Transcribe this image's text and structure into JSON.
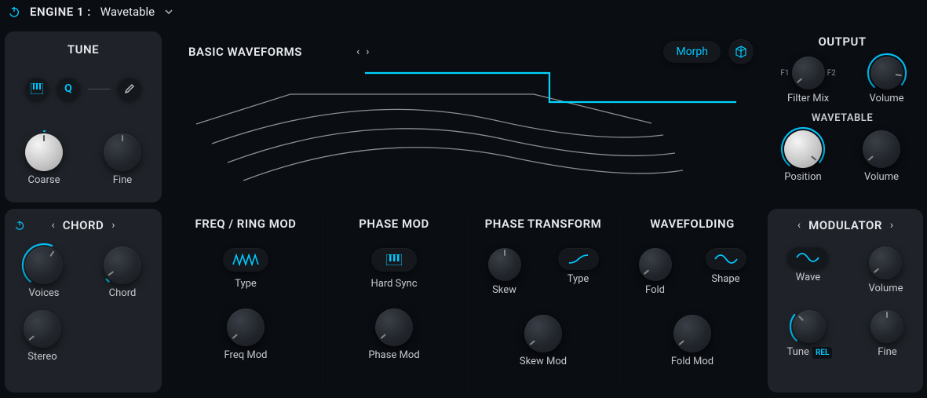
{
  "header": {
    "engine_label": "ENGINE 1 :",
    "engine_type": "Wavetable"
  },
  "tune": {
    "title": "TUNE",
    "coarse": "Coarse",
    "fine": "Fine"
  },
  "waveforms": {
    "title": "BASIC WAVEFORMS",
    "morph": "Morph"
  },
  "output": {
    "title": "OUTPUT",
    "f1": "F1",
    "f2": "F2",
    "filter_mix": "Filter Mix",
    "volume": "Volume",
    "wavetable_title": "WAVETABLE",
    "position": "Position",
    "wt_volume": "Volume"
  },
  "chord": {
    "title": "CHORD",
    "voices": "Voices",
    "chord": "Chord",
    "stereo": "Stereo"
  },
  "freqring": {
    "title": "FREQ / RING MOD",
    "type": "Type",
    "freqmod": "Freq Mod"
  },
  "phasemod": {
    "title": "PHASE MOD",
    "hardsync": "Hard Sync",
    "phasemod": "Phase Mod"
  },
  "phasetrans": {
    "title": "PHASE TRANSFORM",
    "skew": "Skew",
    "type": "Type",
    "skewmod": "Skew Mod"
  },
  "wavefold": {
    "title": "WAVEFOLDING",
    "fold": "Fold",
    "shape": "Shape",
    "foldmod": "Fold Mod"
  },
  "modulator": {
    "title": "MODULATOR",
    "wave": "Wave",
    "volume": "Volume",
    "tune": "Tune",
    "rel": "REL",
    "fine": "Fine"
  }
}
